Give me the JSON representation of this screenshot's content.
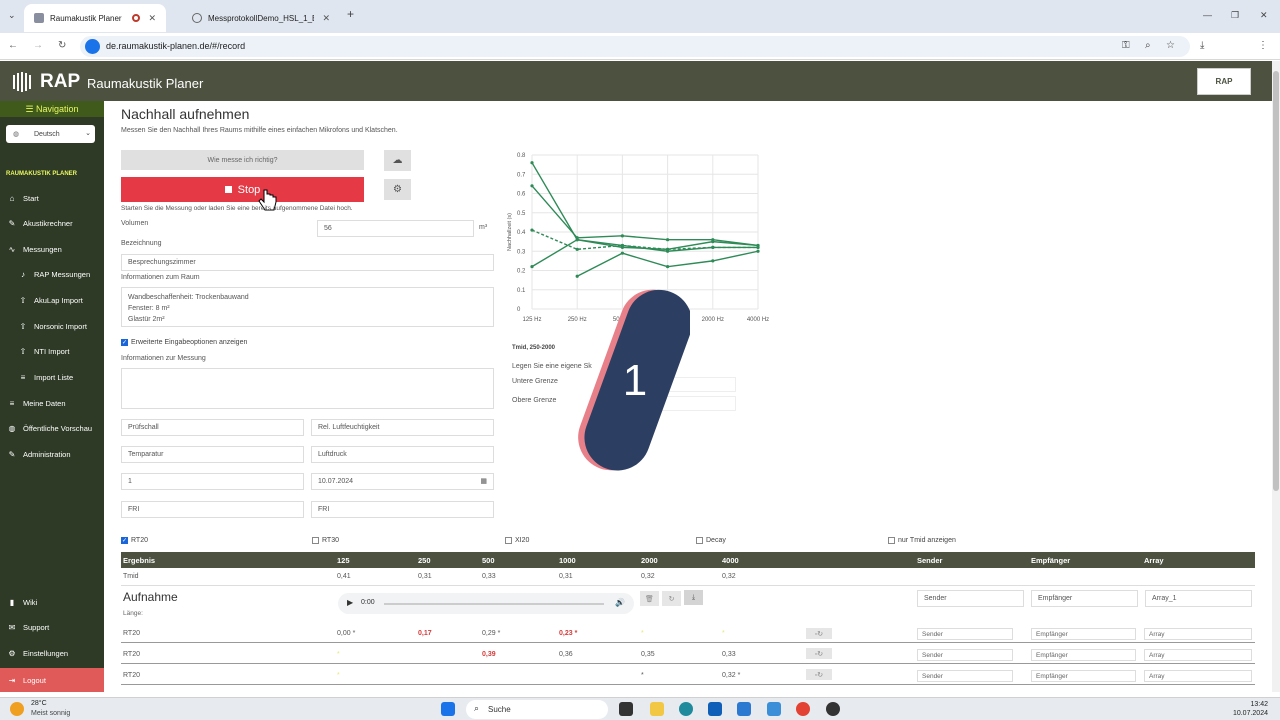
{
  "browser": {
    "tabs": [
      {
        "title": "Raumakustik Planer"
      },
      {
        "title": "MessprotokollDemo_HSL_1_Be"
      }
    ],
    "url": "de.raumakustik-planen.de/#/record"
  },
  "header": {
    "logo": "RAP",
    "product": "Raumakustik Planer",
    "badge": "RAP"
  },
  "sidebar": {
    "nav_title": "Navigation",
    "language": "Deutsch",
    "section": "RAUMAKUSTIK PLANER",
    "items": [
      {
        "label": "Start",
        "icon": "home-icon"
      },
      {
        "label": "Akustikrechner",
        "icon": "edit-icon"
      },
      {
        "label": "Messungen",
        "icon": "wave-icon"
      },
      {
        "label": "RAP Messungen",
        "icon": "mic-icon"
      },
      {
        "label": "AkuLap Import",
        "icon": "upload-icon"
      },
      {
        "label": "Norsonic Import",
        "icon": "upload-icon"
      },
      {
        "label": "NTI Import",
        "icon": "upload-icon"
      },
      {
        "label": "Import Liste",
        "icon": "list-icon"
      },
      {
        "label": "Meine Daten",
        "icon": "list-icon"
      },
      {
        "label": "Öffentliche Vorschau",
        "icon": "globe-icon"
      },
      {
        "label": "Administration",
        "icon": "edit-icon"
      }
    ],
    "bottom": [
      {
        "label": "Wiki",
        "icon": "book-icon"
      },
      {
        "label": "Support",
        "icon": "support-icon"
      },
      {
        "label": "Einstellungen",
        "icon": "gear-icon"
      },
      {
        "label": "Logout",
        "icon": "logout-icon"
      }
    ]
  },
  "main": {
    "title": "Nachhall aufnehmen",
    "subtitle": "Messen Sie den Nachhall Ihres Raums mithilfe eines einfachen Mikrofons und Klatschen.",
    "howto_button": "Wie messe ich richtig?",
    "stop_button": "Stop",
    "hint": "Starten Sie die Messung oder laden Sie eine bereits aufgenommene Datei hoch.",
    "volume_label": "Volumen",
    "volume_value": "56",
    "volume_unit": "m³",
    "bezeichnung_label": "Bezeichnung",
    "bezeichnung_value": "Besprechungszimmer",
    "raum_label": "Informationen zum Raum",
    "raum_value": [
      "Wandbeschaffenheit: Trockenbauwand",
      "Fenster: 8 m²",
      "Glastür 2m²"
    ],
    "extended_label": "Erweiterte Eingabeoptionen anzeigen",
    "messung_label": "Informationen zur Messung",
    "fields": {
      "pruefschall": "Prüfschall",
      "feuchte": "Rel. Luftfeuchtigkeit",
      "temperatur": "Temparatur",
      "luftdruck": "Luftdruck",
      "nummer": "1",
      "datum": "10.07.2024",
      "fr1": "FRI",
      "fr2": "FRI"
    }
  },
  "chart_data": {
    "type": "line",
    "categories": [
      "125 Hz",
      "250 Hz",
      "500 Hz",
      "1000 Hz",
      "2000 Hz",
      "4000 Hz"
    ],
    "ylabel": "Nachhallzeit (s)",
    "ylim": [
      0,
      0.8
    ],
    "yticks": [
      "0",
      "0.1",
      "0.2",
      "0.3",
      "0.4",
      "0.5",
      "0.6",
      "0.7",
      "0.8"
    ],
    "xtick_labels": [
      "125 Hz",
      "250 Hz",
      "500 Hz",
      "",
      "2000 Hz",
      "4000 Hz"
    ],
    "grid": true,
    "series": [
      {
        "values": [
          0.76,
          0.36,
          0.32,
          0.31,
          0.35,
          0.33
        ],
        "dashed": false
      },
      {
        "values": [
          0.64,
          0.37,
          0.38,
          0.36,
          0.36,
          0.33
        ],
        "dashed": false
      },
      {
        "values": [
          0.22,
          0.36,
          0.33,
          0.3,
          0.32,
          0.32
        ],
        "dashed": false
      },
      {
        "values": [
          null,
          0.17,
          0.29,
          0.22,
          0.25,
          0.3
        ],
        "dashed": false
      },
      {
        "values": [
          0.41,
          0.31,
          0.33,
          0.31,
          0.32,
          0.32
        ],
        "dashed": true
      }
    ],
    "color": "#2e8b57"
  },
  "under_chart": {
    "tmid": "Tmid, 250-2000",
    "legen": "Legen Sie eine eigene Sk",
    "untere": "Untere Grenze",
    "obere": "Obere Grenze"
  },
  "overlay": {
    "number": "1"
  },
  "checkboxes": [
    "RT20",
    "RT30",
    "XI20",
    "Decay",
    "nur Tmid anzeigen"
  ],
  "table": {
    "headers": [
      "Ergebnis",
      "125",
      "250",
      "500",
      "1000",
      "2000",
      "4000",
      "Sender",
      "Empfänger",
      "Array"
    ],
    "tmid_label": "Tmid",
    "tmid_values": [
      "0,41",
      "0,31",
      "0,33",
      "0,31",
      "0,32",
      "0,32"
    ],
    "recording_title": "Aufnahme",
    "length_label": "Länge:",
    "player_time": "0:00",
    "sender_placeholder": "Sender",
    "empfaenger_placeholder": "Empfänger",
    "array_value": "Array_1",
    "rows": [
      {
        "label": "RT20",
        "values": [
          "0,00 *",
          "0,17",
          "0,29 *",
          "0,23 *",
          "*",
          "*"
        ],
        "sender": "Sender",
        "empfaenger": "Empfänger",
        "array": "Array"
      },
      {
        "label": "RT20",
        "values": [
          "*",
          "",
          "0,39",
          "0,36",
          "0,35",
          "0,33"
        ],
        "sender": "Sender",
        "empfaenger": "Empfänger",
        "array": "Array"
      },
      {
        "label": "RT20",
        "values": [
          "*",
          "",
          "",
          "",
          "*",
          "0,32 *"
        ],
        "sender": "Sender",
        "empfaenger": "Empfänger",
        "array": "Array"
      }
    ]
  },
  "taskbar": {
    "temp": "28°C",
    "weather": "Meist sonnig",
    "search": "Suche",
    "time": "13:42",
    "date": "10.07.2024"
  }
}
